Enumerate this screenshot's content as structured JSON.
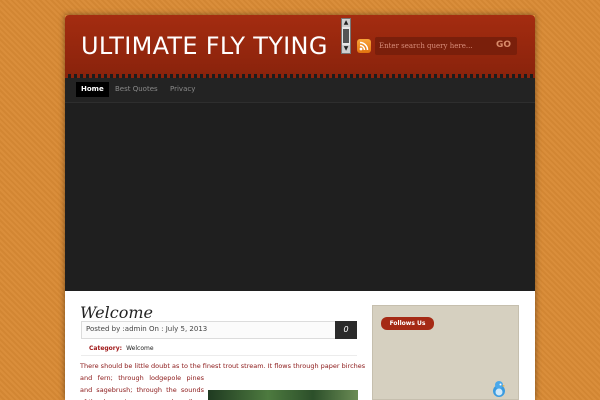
{
  "header": {
    "site_title": "ULTIMATE FLY TYING",
    "search_placeholder": "Enter search query here...",
    "search_button": "GO",
    "rss_icon": "rss-icon",
    "accent_color": "#a42c10"
  },
  "nav": {
    "items": [
      {
        "label": "Home",
        "active": true
      },
      {
        "label": "Best Quotes",
        "active": false
      },
      {
        "label": "Privacy",
        "active": false
      }
    ]
  },
  "post": {
    "title": "Welcome",
    "meta": "Posted by :admin On : July 5, 2013",
    "comment_count": "0",
    "category_label": "Category:",
    "category_value": "Welcome",
    "line1": "There should be little doubt as to the finest trout stream. It flows through paper birches",
    "line2": "and fern; through lodgepole pines and sagebrush; through the sounds of the drumming grouse and smells"
  },
  "sidebar": {
    "follow_label": "Follows Us",
    "bird_icon": "twitter-bird-icon"
  }
}
